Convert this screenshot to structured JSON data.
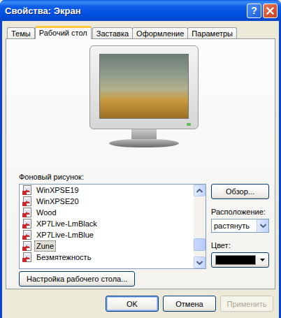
{
  "window": {
    "title": "Свойства: Экран",
    "help": "?"
  },
  "tabs": [
    {
      "label": "Темы",
      "selected": false
    },
    {
      "label": "Рабочий стол",
      "selected": true
    },
    {
      "label": "Заставка",
      "selected": false
    },
    {
      "label": "Оформление",
      "selected": false
    },
    {
      "label": "Параметры",
      "selected": false
    }
  ],
  "background": {
    "label": "Фоновый рисунок:",
    "items": [
      {
        "name": "WinXPSE19",
        "selected": false
      },
      {
        "name": "WinXPSE20",
        "selected": false
      },
      {
        "name": "Wood",
        "selected": false
      },
      {
        "name": "XP7Live-LmBlack",
        "selected": false
      },
      {
        "name": "XP7Live-LmBlue",
        "selected": false
      },
      {
        "name": "Zune",
        "selected": true
      },
      {
        "name": "Безмятежность",
        "selected": false
      }
    ],
    "scroll": {
      "level": 0.88
    }
  },
  "browse_button": "Обзор...",
  "position": {
    "label": "Расположение:",
    "value": "растянуть"
  },
  "color": {
    "label": "Цвет:",
    "value": "#000000"
  },
  "customize_button": "Настройка рабочего стола...",
  "buttons": [
    {
      "label": "OK",
      "default": true,
      "disabled": false
    },
    {
      "label": "Отмена",
      "default": false,
      "disabled": false
    },
    {
      "label": "Применить",
      "default": false,
      "disabled": true
    }
  ]
}
